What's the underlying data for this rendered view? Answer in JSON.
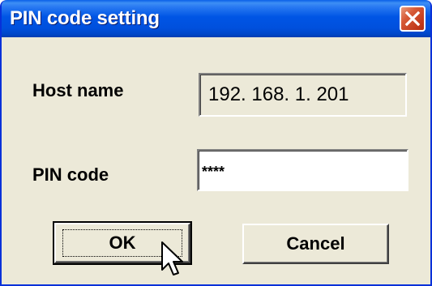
{
  "window": {
    "title": "PIN code setting"
  },
  "host": {
    "label": "Host name",
    "value": "192. 168. 1. 201"
  },
  "pin": {
    "label": "PIN code",
    "value": "****"
  },
  "buttons": {
    "ok_label": "OK",
    "cancel_label": "Cancel"
  },
  "icons": {
    "close": "close-icon",
    "cursor": "mouse-pointer-icon"
  },
  "colors": {
    "titlebar": "#0055e5",
    "close_button": "#d65a36",
    "dialog_background": "#ece9d8"
  }
}
